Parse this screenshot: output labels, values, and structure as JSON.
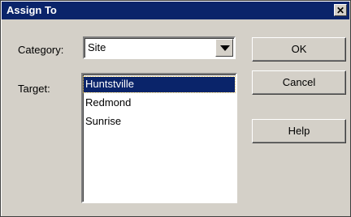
{
  "window": {
    "title": "Assign To",
    "close_glyph": "✕"
  },
  "form": {
    "category_label": "Category:",
    "category_value": "Site",
    "target_label": "Target:",
    "targets": [
      {
        "label": "Huntstville",
        "selected": true
      },
      {
        "label": "Redmond",
        "selected": false
      },
      {
        "label": "Sunrise",
        "selected": false
      }
    ]
  },
  "buttons": {
    "ok": "OK",
    "cancel": "Cancel",
    "help": "Help"
  },
  "colors": {
    "title_bar": "#0a246a",
    "dialog_face": "#d4d0c8",
    "selection": "#0a246a"
  }
}
